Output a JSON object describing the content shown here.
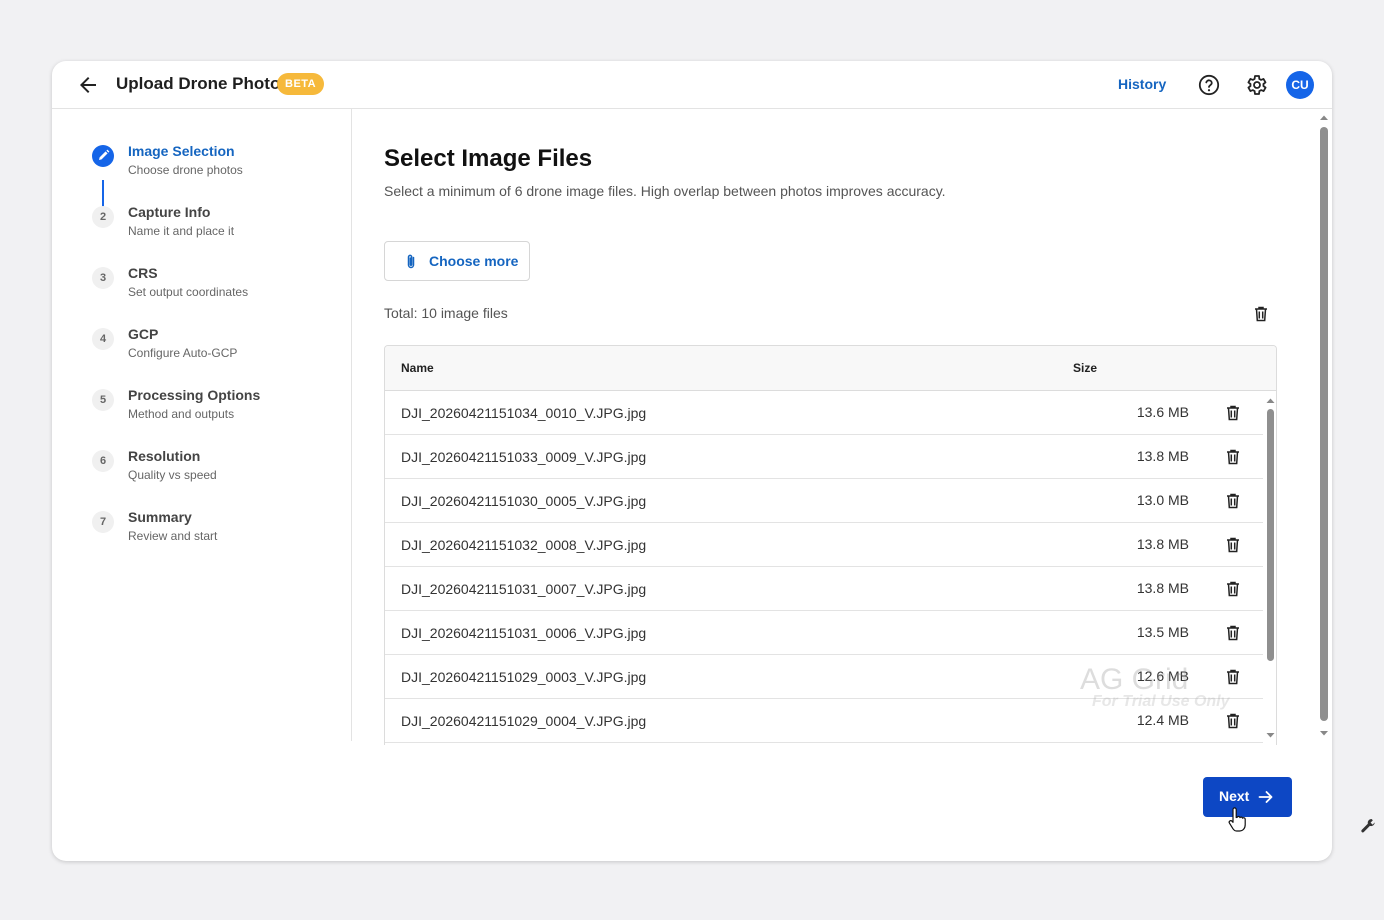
{
  "header": {
    "title": "Upload Drone Photos",
    "beta_badge": "BETA",
    "history_label": "History",
    "avatar_initials": "CU",
    "icons": [
      "arrow-back-icon",
      "help-circle-icon",
      "gear-icon"
    ]
  },
  "steps": [
    {
      "num": "",
      "label": "Image Selection",
      "sub": "Choose drone photos",
      "active": true,
      "icon": "pencil-icon"
    },
    {
      "num": "2",
      "label": "Capture Info",
      "sub": "Name it and place it",
      "active": false
    },
    {
      "num": "3",
      "label": "CRS",
      "sub": "Set output coordinates",
      "active": false
    },
    {
      "num": "4",
      "label": "GCP",
      "sub": "Configure Auto-GCP",
      "active": false
    },
    {
      "num": "5",
      "label": "Processing Options",
      "sub": "Method and outputs",
      "active": false
    },
    {
      "num": "6",
      "label": "Resolution",
      "sub": "Quality vs speed",
      "active": false
    },
    {
      "num": "7",
      "label": "Summary",
      "sub": "Review and start",
      "active": false
    }
  ],
  "main": {
    "heading": "Select Image Files",
    "description": "Select a minimum of 6 drone image files. High overlap between photos improves accuracy.",
    "choose_more_label": "Choose more",
    "total_label": "Total: 10 image files"
  },
  "grid": {
    "columns": [
      "Name",
      "Size"
    ],
    "rows": [
      {
        "name": "DJI_20260421151034_0010_V.JPG.jpg",
        "size": "13.6 MB"
      },
      {
        "name": "DJI_20260421151033_0009_V.JPG.jpg",
        "size": "13.8 MB"
      },
      {
        "name": "DJI_20260421151030_0005_V.JPG.jpg",
        "size": "13.0 MB"
      },
      {
        "name": "DJI_20260421151032_0008_V.JPG.jpg",
        "size": "13.8 MB"
      },
      {
        "name": "DJI_20260421151031_0007_V.JPG.jpg",
        "size": "13.8 MB"
      },
      {
        "name": "DJI_20260421151031_0006_V.JPG.jpg",
        "size": "13.5 MB"
      },
      {
        "name": "DJI_20260421151029_0003_V.JPG.jpg",
        "size": "12.6 MB"
      },
      {
        "name": "DJI_20260421151029_0004_V.JPG.jpg",
        "size": "12.4 MB"
      }
    ],
    "watermark_title": "AG Grid",
    "watermark_sub": "For Trial Use Only"
  },
  "footer": {
    "next_label": "Next"
  },
  "colors": {
    "accent": "#1565c0",
    "primary_button": "#0d47c4",
    "beta": "#f6b93b"
  }
}
